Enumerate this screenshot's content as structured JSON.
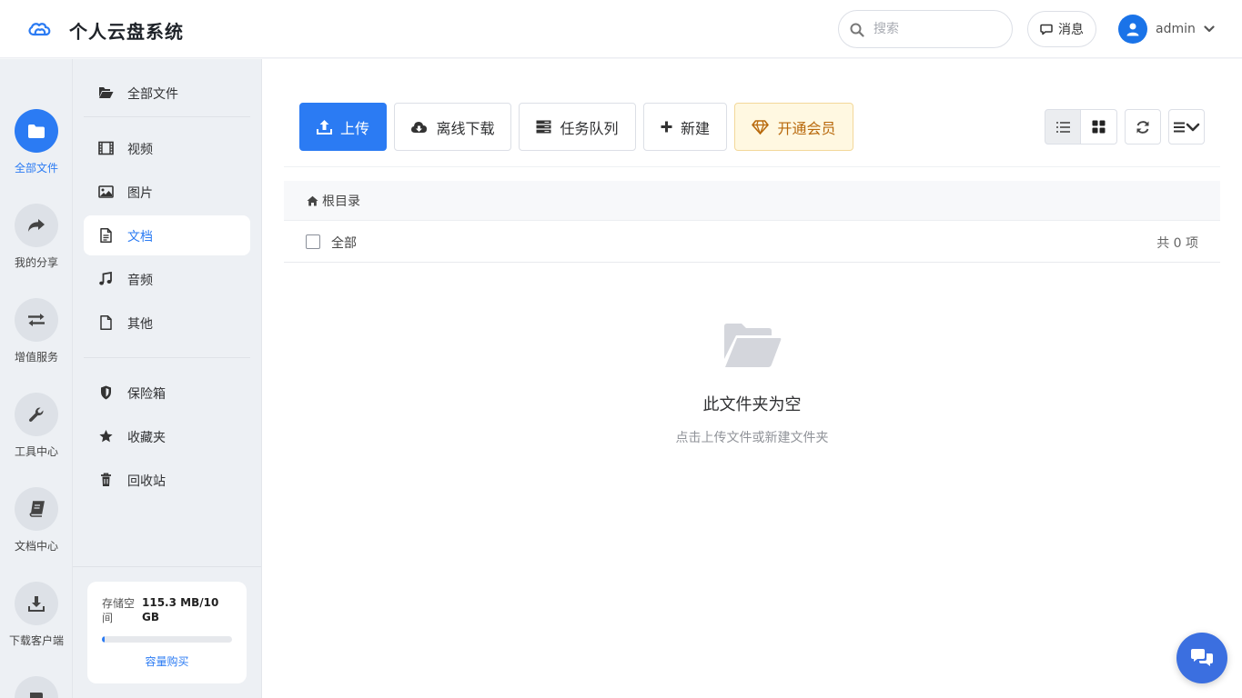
{
  "app": {
    "title": "个人云盘系统"
  },
  "header": {
    "search_placeholder": "搜索",
    "messages_label": "消息",
    "username": "admin"
  },
  "rail": {
    "items": [
      {
        "label": "全部文件",
        "icon": "folder-icon",
        "active": true
      },
      {
        "label": "我的分享",
        "icon": "share-icon"
      },
      {
        "label": "增值服务",
        "icon": "exchange-icon"
      },
      {
        "label": "工具中心",
        "icon": "wrench-icon"
      },
      {
        "label": "文档中心",
        "icon": "book-icon"
      },
      {
        "label": "下载客户端",
        "icon": "download-icon"
      }
    ]
  },
  "sidebar": {
    "items": [
      {
        "label": "全部文件",
        "icon": "folder-open-icon"
      },
      {
        "label": "视频",
        "icon": "film-icon"
      },
      {
        "label": "图片",
        "icon": "image-icon"
      },
      {
        "label": "文档",
        "icon": "document-icon",
        "active": true
      },
      {
        "label": "音频",
        "icon": "music-icon"
      },
      {
        "label": "其他",
        "icon": "file-icon"
      },
      {
        "label": "保险箱",
        "icon": "shield-icon"
      },
      {
        "label": "收藏夹",
        "icon": "star-icon"
      },
      {
        "label": "回收站",
        "icon": "trash-icon"
      }
    ],
    "storage": {
      "label": "存储空间",
      "value": "115.3 MB/10 GB",
      "used_fraction": 0.011,
      "buy_label": "容量购买"
    }
  },
  "toolbar": {
    "upload_label": "上传",
    "offline_download_label": "离线下载",
    "task_queue_label": "任务队列",
    "new_label": "新建",
    "vip_label": "开通会员"
  },
  "breadcrumb": {
    "root_label": "根目录"
  },
  "list": {
    "select_all_label": "全部",
    "count_label": "共 0 项"
  },
  "empty": {
    "title": "此文件夹为空",
    "subtitle": "点击上传文件或新建文件夹"
  },
  "colors": {
    "accent": "#2b7bf3",
    "vip_bg": "#fff8e1",
    "vip_text": "#b8690c",
    "chat_fab": "#3b6fe0"
  }
}
